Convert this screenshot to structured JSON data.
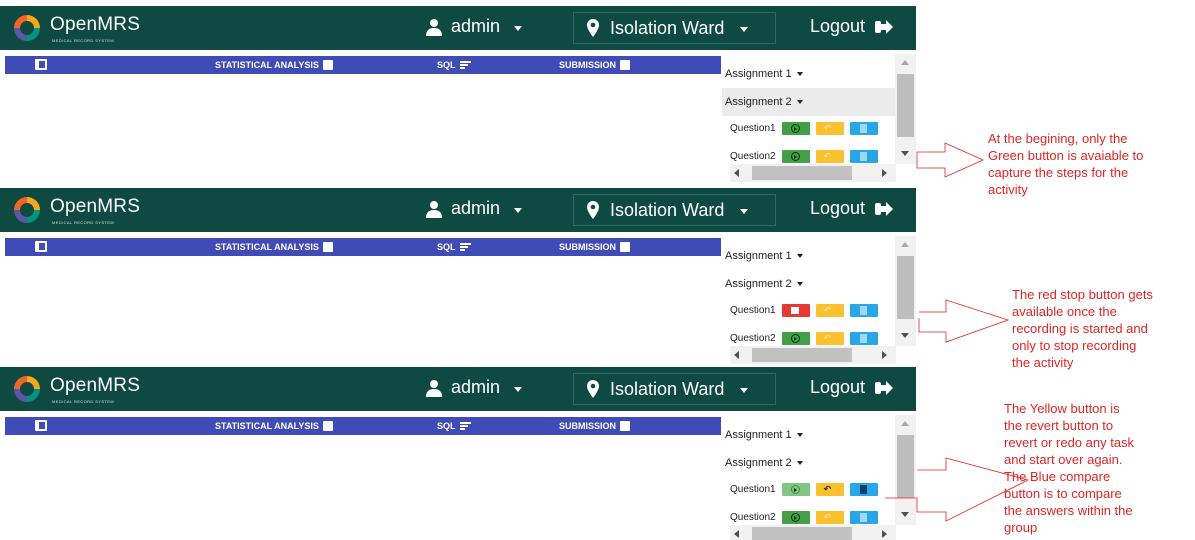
{
  "header": {
    "brand": "OpenMRS",
    "brand_sub": "MEDICAL RECORD SYSTEM",
    "user": "admin",
    "location": "Isolation Ward",
    "logout": "Logout"
  },
  "nav": {
    "statistical": "STATISTICAL ANALYSIS",
    "sql": "SQL",
    "submission": "SUBMISSION"
  },
  "sidebar": {
    "assignment1": "Assignment 1",
    "assignment2": "Assignment 2",
    "question1": "Question1",
    "question2": "Question2"
  },
  "notes": {
    "note1": [
      "At the begining, only the",
      "Green button is avaiable to",
      "capture the steps for the",
      "activity"
    ],
    "note2": [
      "The red stop button gets",
      "available once the",
      "recording is started and",
      "only to stop recording",
      "the activity"
    ],
    "note3": [
      "The Yellow button is",
      "the revert button to",
      "revert or redo any task",
      "and start over again.",
      "The Blue compare",
      "button is to compare",
      "the answers within the",
      "group"
    ]
  },
  "colors": {
    "header_bg": "#0e4a41",
    "nav_bg": "#3f4bb6",
    "green": "#43a047",
    "red": "#e53935",
    "yellow": "#fbc02d",
    "blue": "#29a6e8",
    "annotation": "#e32424"
  }
}
